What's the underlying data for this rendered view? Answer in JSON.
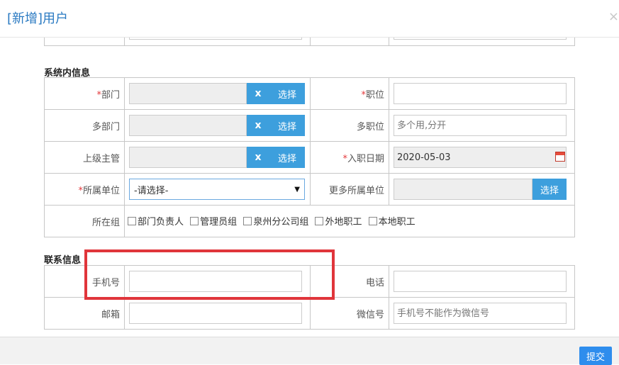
{
  "dialog": {
    "title": "[新增]用户",
    "close_icon": "×"
  },
  "top_row": {
    "left_value": "",
    "right_value": ""
  },
  "system_section": {
    "heading": "系统内信息",
    "department": {
      "label": "部门",
      "clear": "x",
      "select": "选择"
    },
    "position": {
      "label": "职位"
    },
    "multi_department": {
      "label": "多部门",
      "clear": "x",
      "select": "选择"
    },
    "multi_position": {
      "label": "多职位",
      "placeholder": "多个用,分开"
    },
    "supervisor": {
      "label": "上级主管",
      "clear": "x",
      "select": "选择"
    },
    "hire_date": {
      "label": "入职日期",
      "value": "2020-05-03"
    },
    "unit": {
      "label": "所属单位",
      "selected": "-请选择-"
    },
    "more_units": {
      "label": "更多所属单位",
      "select": "选择"
    },
    "group": {
      "label": "所在组",
      "options": [
        "部门负责人",
        "管理员组",
        "泉州分公司组",
        "外地职工",
        "本地职工"
      ]
    }
  },
  "contact_section": {
    "heading": "联系信息",
    "mobile": {
      "label": "手机号",
      "value": ""
    },
    "phone": {
      "label": "电话",
      "value": ""
    },
    "email": {
      "label": "邮箱",
      "value": ""
    },
    "wechat": {
      "label": "微信号",
      "placeholder": "手机号不能作为微信号"
    }
  },
  "required_mark": "*",
  "footer": {
    "submit_label": "提交"
  }
}
